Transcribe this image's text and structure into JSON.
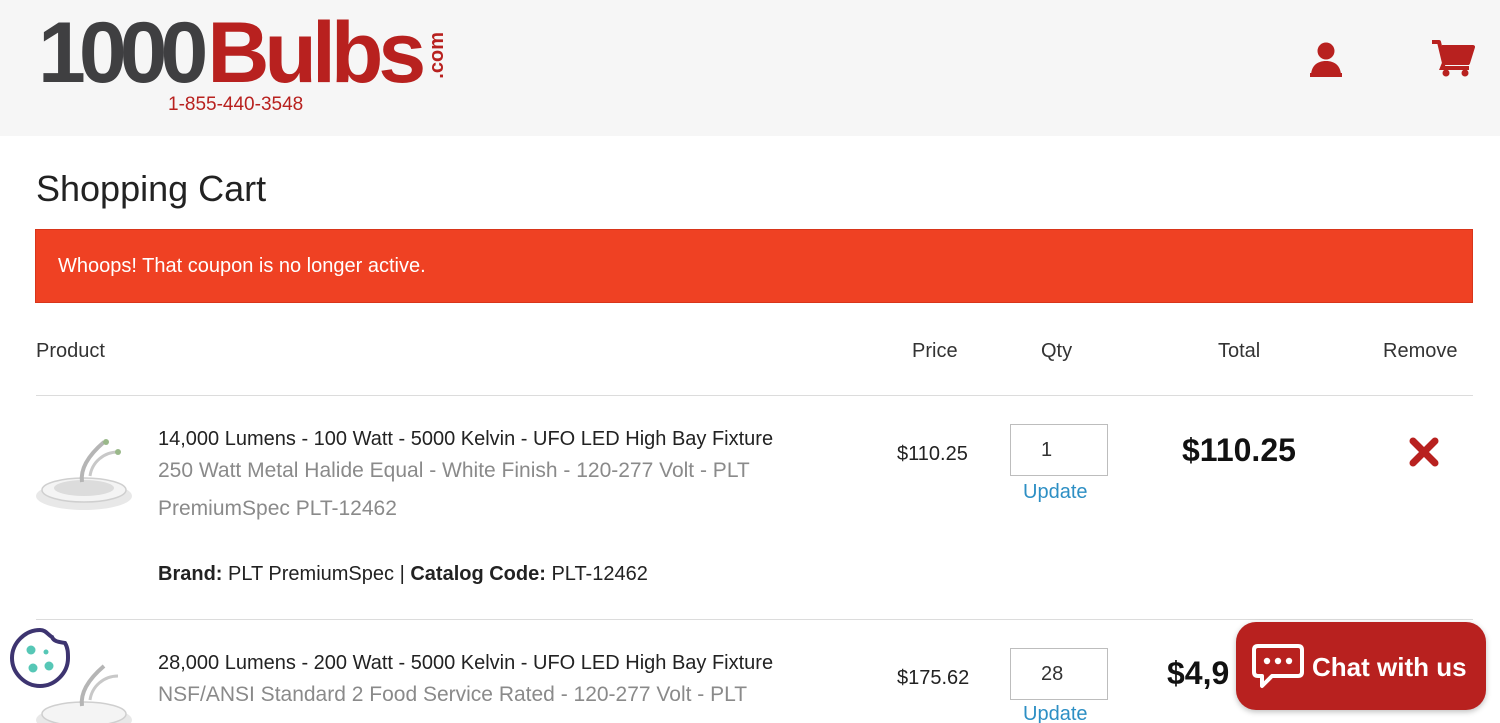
{
  "header": {
    "logo_number": "1000",
    "logo_word": "Bulbs",
    "logo_suffix": ".com",
    "phone": "1-855-440-3548"
  },
  "page": {
    "title": "Shopping Cart"
  },
  "alert": {
    "message": "Whoops! That coupon is no longer active."
  },
  "table": {
    "headers": {
      "product": "Product",
      "price": "Price",
      "qty": "Qty",
      "total": "Total",
      "remove": "Remove"
    }
  },
  "items": [
    {
      "title": "14,000 Lumens - 100 Watt - 5000 Kelvin - UFO LED High Bay Fixture",
      "subtitle": "250 Watt Metal Halide Equal - White Finish - 120-277 Volt - PLT PremiumSpec PLT-12462",
      "brand_label": "Brand:",
      "brand": "PLT PremiumSpec",
      "separator": "|",
      "catalog_label": "Catalog Code:",
      "catalog": "PLT-12462",
      "price": "$110.25",
      "qty": "1",
      "update": "Update",
      "total": "$110.25"
    },
    {
      "title": "28,000 Lumens - 200 Watt - 5000 Kelvin - UFO LED High Bay Fixture",
      "subtitle": "NSF/ANSI Standard 2 Food Service Rated - 120-277 Volt - PLT",
      "price": "$175.62",
      "qty": "28",
      "update": "Update",
      "total": "$4,9"
    }
  ],
  "chat": {
    "label": "Chat with us"
  },
  "icons": {
    "account": "user-icon",
    "cart": "cart-icon",
    "remove": "close-icon",
    "cookie": "cookie-icon",
    "chat": "chat-bubble-icon"
  },
  "colors": {
    "brand_red": "#b8211f",
    "alert_bg": "#ef4123",
    "link_blue": "#2d8fc4"
  }
}
